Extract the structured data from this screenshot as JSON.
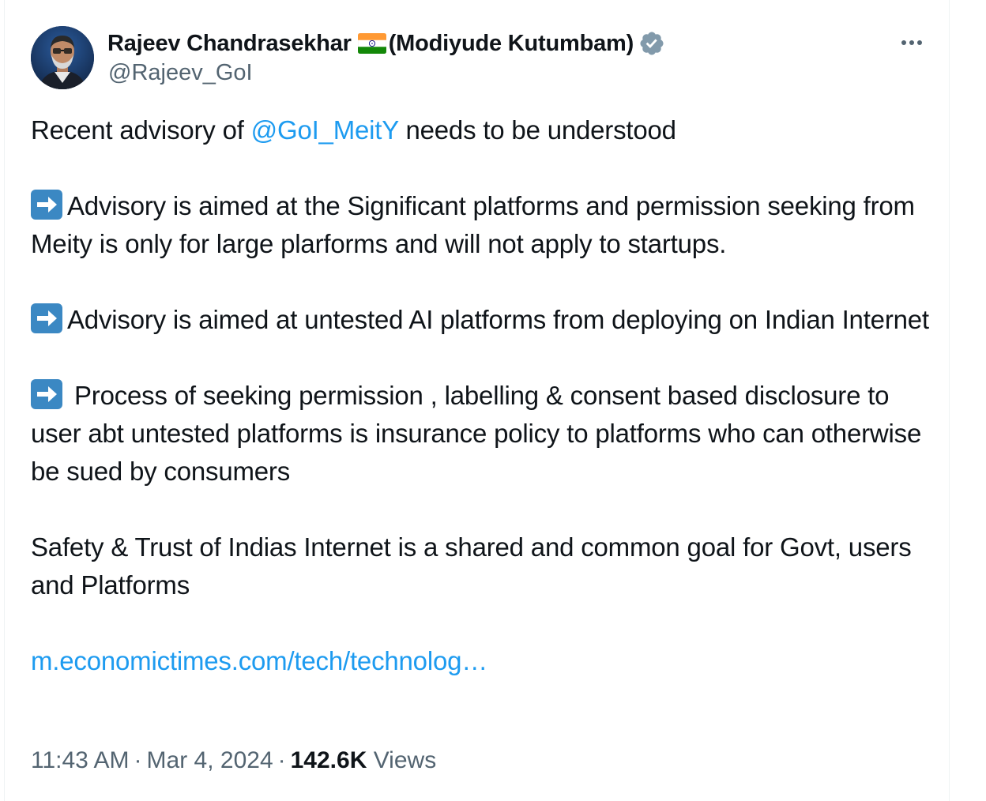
{
  "author": {
    "name": "Rajeev Chandrasekhar",
    "name_suffix": "(Modiyude Kutumbam)",
    "handle": "@Rajeev_GoI",
    "flag_icon": "india-flag-icon",
    "verified_icon": "verified-badge-icon",
    "verified_color": "#829aab"
  },
  "menu": {
    "more_icon": "more-horizontal-icon"
  },
  "tweet": {
    "line1_prefix": "Recent advisory of ",
    "line1_mention": "@GoI_MeitY",
    "line1_suffix": " needs to be  understood",
    "point1": "Advisory is aimed at the Significant platforms and permission seeking from Meity is only for large plarforms and will not apply to startups.",
    "point2": "Advisory is aimed at untested AI platforms from deploying on Indian Internet",
    "point3": " Process of seeking permission , labelling & consent based disclosure to user abt untested platforms is insurance policy to platforms who can otherwise be sued by consumers",
    "closing": "Safety & Trust of Indias Internet is a shared and common goal for Govt, users and Platforms",
    "link_text": "m.economictimes.com/tech/technolog…",
    "bullet_icon": "right-arrow-emoji-icon"
  },
  "meta": {
    "time": "11:43 AM",
    "separator": "·",
    "date": "Mar 4, 2024",
    "views_count": "142.6K",
    "views_label": "Views"
  },
  "colors": {
    "link": "#1d9bf0",
    "secondary_text": "#536471",
    "primary_text": "#0f1419",
    "arrow_emoji_bg": "#3b88c3"
  }
}
